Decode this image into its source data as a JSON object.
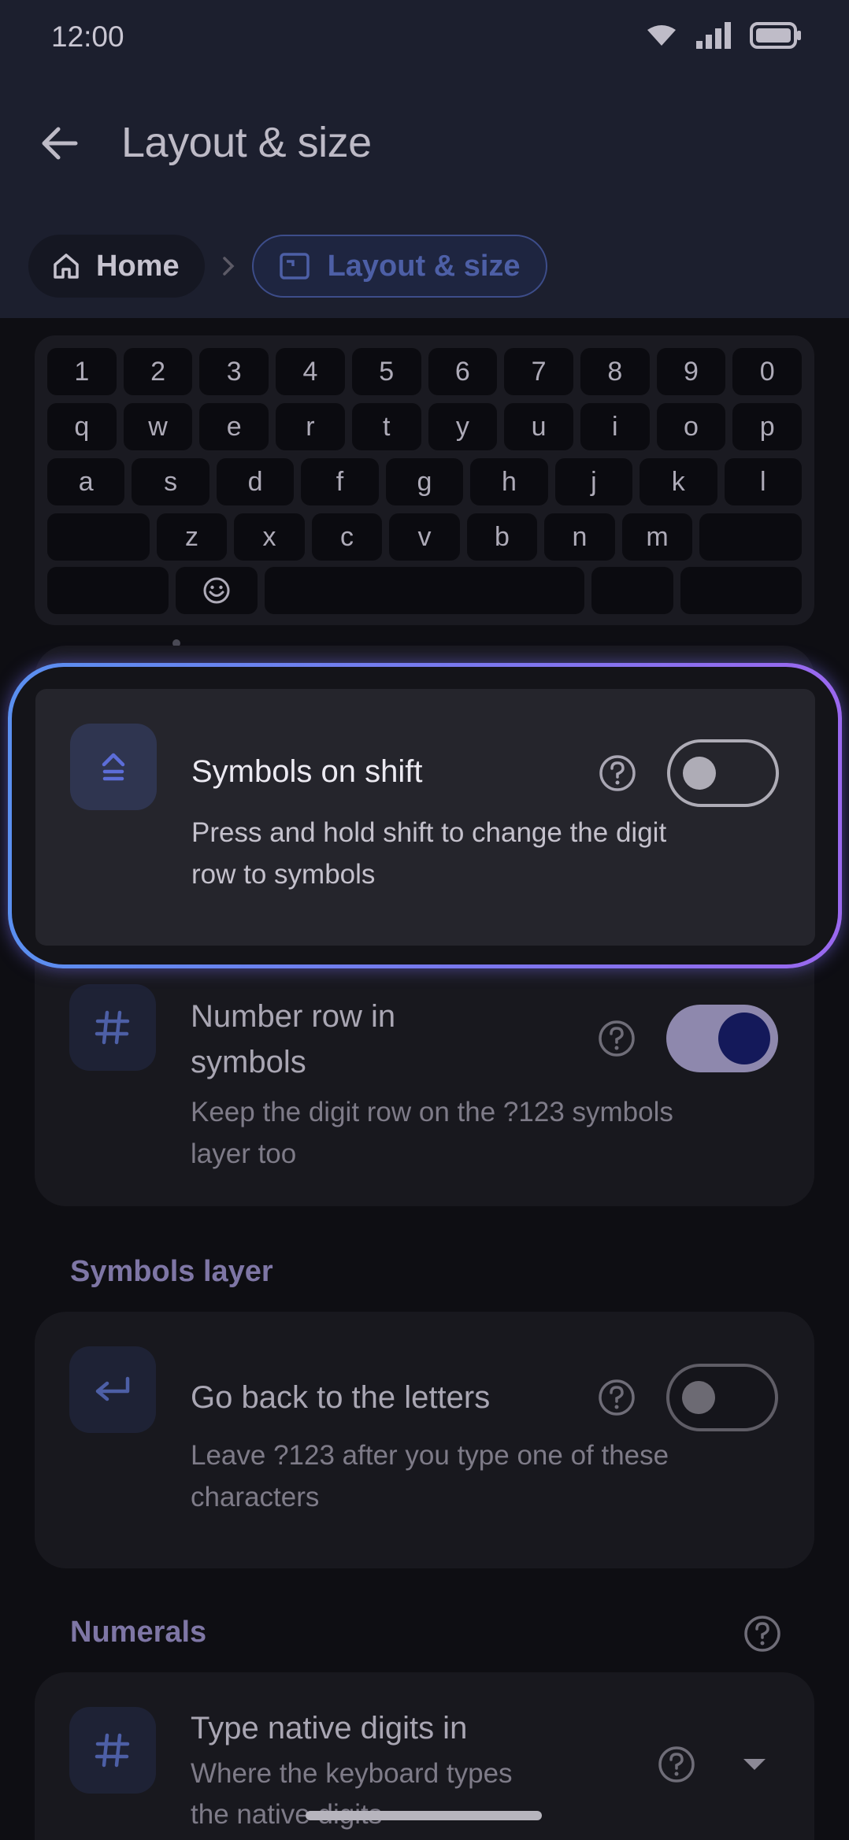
{
  "status": {
    "time": "12:00"
  },
  "appbar": {
    "title": "Layout & size"
  },
  "breadcrumb": {
    "home": "Home",
    "current": "Layout & size"
  },
  "keyboard": {
    "rows": [
      [
        "1",
        "2",
        "3",
        "4",
        "5",
        "6",
        "7",
        "8",
        "9",
        "0"
      ],
      [
        "q",
        "w",
        "e",
        "r",
        "t",
        "y",
        "u",
        "i",
        "o",
        "p"
      ],
      [
        "a",
        "s",
        "d",
        "f",
        "g",
        "h",
        "j",
        "k",
        "l"
      ],
      [
        "",
        "z",
        "x",
        "c",
        "v",
        "b",
        "n",
        "m",
        ""
      ],
      [
        "",
        "☺",
        "",
        "",
        ""
      ]
    ]
  },
  "settings": {
    "symbols_on_shift": {
      "title": "Symbols on shift",
      "desc_line1": "Press and hold shift to change the digit",
      "desc_line2": "row to symbols",
      "enabled": false
    },
    "number_row": {
      "title_line1": "Number row in",
      "title_line2": "symbols",
      "desc_line1": "Keep the digit row on the ?123 symbols",
      "desc_line2": "layer too",
      "enabled": true
    },
    "symbols_layer_label": "Symbols layer",
    "go_back": {
      "title": "Go back to the letters",
      "desc_line1": "Leave ?123 after you type one of these",
      "desc_line2": "characters",
      "enabled": false
    },
    "numerals_label": "Numerals",
    "native_digits": {
      "title": "Type native digits in",
      "desc_line1": "Where the keyboard types",
      "desc_line2": "the native digits"
    }
  },
  "colors": {
    "accent": "#4d5fa6",
    "highlight_start": "#5a8ff0",
    "highlight_end": "#9a68ef",
    "toggle_on": "#8e88ad"
  }
}
